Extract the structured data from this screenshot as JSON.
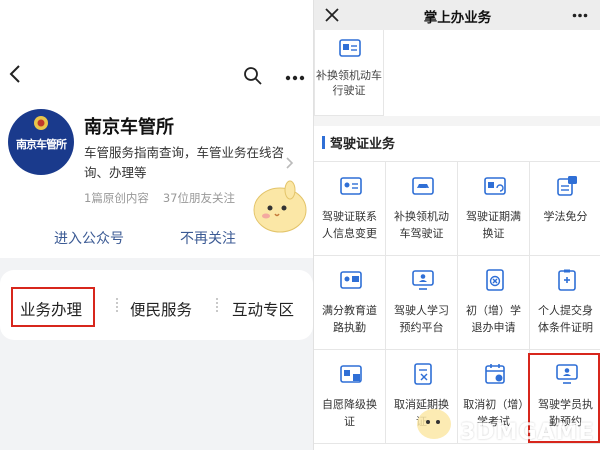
{
  "left_panel": {
    "account_name": "南京车管所",
    "avatar_text": "南京车管所",
    "description": "车管服务指南查询，车管业务在线咨询、办理等",
    "meta": {
      "articles": "1篇原创内容",
      "followers": "37位朋友关注"
    },
    "follow_label": "进入公众号",
    "unfollow_label": "不再关注",
    "menu": [
      {
        "label": "业务办理",
        "highlighted": true
      },
      {
        "label": "便民服务"
      },
      {
        "label": "互动专区"
      }
    ],
    "highlight_color": "#d7261c"
  },
  "right_panel": {
    "title": "掌上办业务",
    "top_card_label": "补换领机动车行驶证",
    "section_title": "驾驶证业务",
    "accent_color": "#2f6fd6",
    "services": [
      {
        "label": "驾驶证联系人信息变更",
        "icon": "id-card-icon"
      },
      {
        "label": "补换领机动车驾驶证",
        "icon": "car-card-icon"
      },
      {
        "label": "驾驶证期满换证",
        "icon": "license-renew-icon"
      },
      {
        "label": "学法免分",
        "icon": "study-badge-icon"
      },
      {
        "label": "满分教育道路执勤",
        "icon": "full-score-icon"
      },
      {
        "label": "驾驶人学习预约平台",
        "icon": "monitor-person-icon"
      },
      {
        "label": "初（增）学退办申请",
        "icon": "cancel-doc-icon"
      },
      {
        "label": "个人提交身体条件证明",
        "icon": "medical-form-icon"
      },
      {
        "label": "自愿降级换证",
        "icon": "downgrade-card-icon"
      },
      {
        "label": "取消延期换证",
        "icon": "cancel-extension-icon"
      },
      {
        "label": "取消初（增）学考试",
        "icon": "calendar-cancel-icon"
      },
      {
        "label": "驾驶学员执勤预约",
        "icon": "trainee-monitor-icon",
        "highlighted": true
      }
    ]
  },
  "watermark": "3DMGAME"
}
